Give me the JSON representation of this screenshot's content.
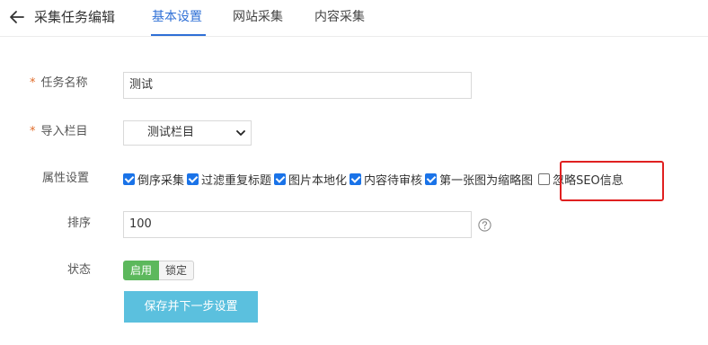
{
  "header": {
    "title": "采集任务编辑",
    "tabs": [
      {
        "label": "基本设置",
        "active": true
      },
      {
        "label": "网站采集",
        "active": false
      },
      {
        "label": "内容采集",
        "active": false
      }
    ]
  },
  "form": {
    "required_mark": "*",
    "task_name": {
      "label": "任务名称",
      "value": "测试"
    },
    "import_column": {
      "label": "导入栏目",
      "selected": "测试栏目"
    },
    "attributes": {
      "label": "属性设置",
      "options": [
        {
          "label": "倒序采集",
          "checked": true
        },
        {
          "label": "过滤重复标题",
          "checked": true
        },
        {
          "label": "图片本地化",
          "checked": true
        },
        {
          "label": "内容待审核",
          "checked": true
        },
        {
          "label": "第一张图为缩略图",
          "checked": true
        },
        {
          "label": "忽略SEO信息",
          "checked": false
        }
      ]
    },
    "sort": {
      "label": "排序",
      "value": "100"
    },
    "status": {
      "label": "状态",
      "enabled_label": "启用",
      "locked_label": "锁定",
      "selected": "启用"
    },
    "submit_label": "保存并下一步设置"
  },
  "colors": {
    "accent": "#2e6fd6",
    "required": "#e06c2a",
    "highlight": "#e02020",
    "enabled": "#5cb85c",
    "submit": "#5bc0de",
    "checkbox": "#1a73e8"
  }
}
